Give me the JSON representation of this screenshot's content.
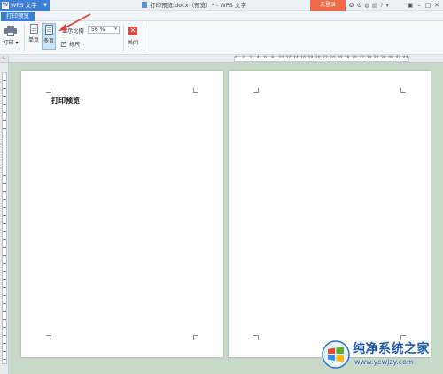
{
  "titlebar": {
    "app_name": "WPS 文字",
    "app_logo": "W",
    "document_title": "打印预览.docx（预览）* - WPS 文字",
    "login_label": "未登录"
  },
  "tabs": {
    "active": "打印预览"
  },
  "ribbon": {
    "print_label": "打印",
    "single_page_label": "单页",
    "multi_page_label": "多页",
    "zoom_label": "显示比例",
    "zoom_value": "56 %",
    "ruler_label": "标尺",
    "ruler_checked": true,
    "close_label": "关闭"
  },
  "ruler": {
    "ticks": [
      "4",
      "2",
      "2",
      "4",
      "6",
      "8",
      "10",
      "12",
      "14",
      "16",
      "18",
      "20",
      "22",
      "24",
      "26",
      "28",
      "30",
      "32",
      "34",
      "36",
      "38",
      "40",
      "42",
      "44"
    ]
  },
  "document": {
    "heading": "打印预览",
    "page_count_visible": 2
  },
  "watermark": {
    "title": "纯净系统之家",
    "url": "www.ycwjzy.com"
  },
  "colors": {
    "accent": "#3a7fd5",
    "login": "#ee6a48",
    "close": "#e0463c",
    "workspace_bg": "#c8d9c8",
    "annotation_arrow": "#e03c3c"
  }
}
